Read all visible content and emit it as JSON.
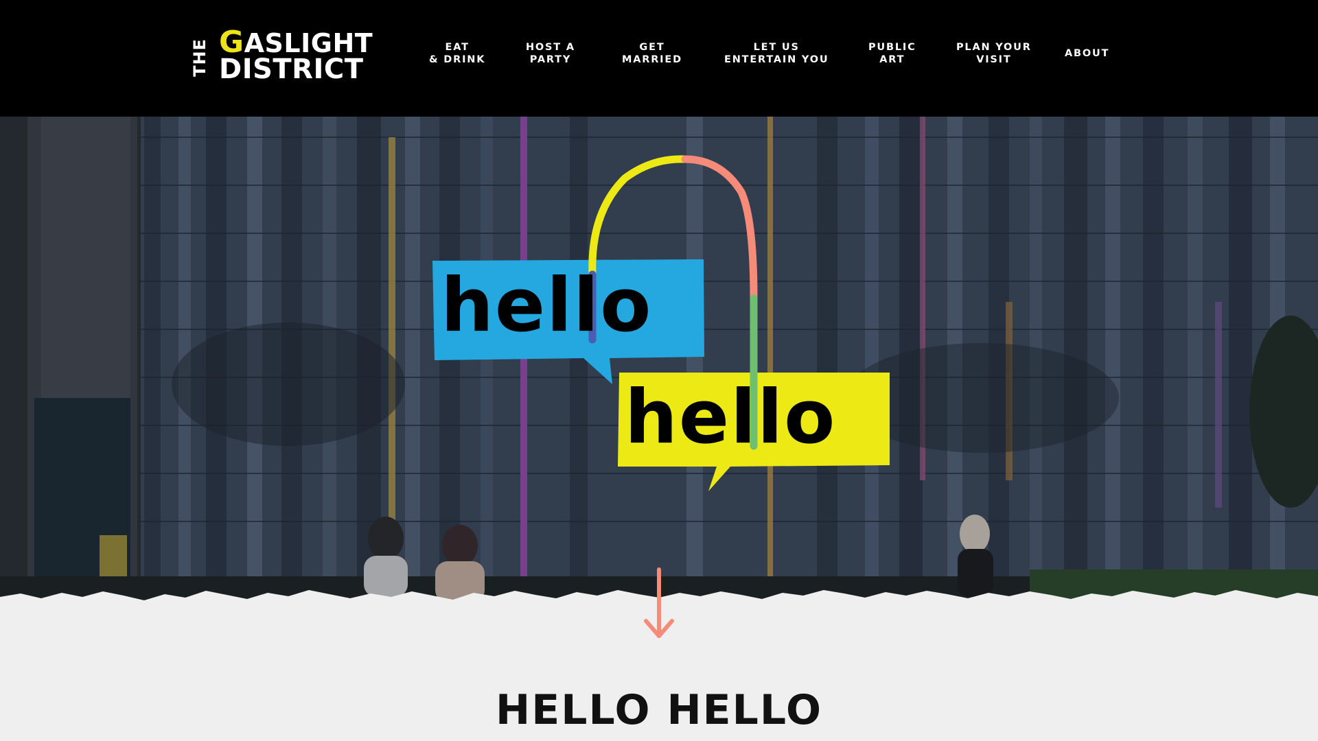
{
  "header": {
    "logo": {
      "the": "THE",
      "line1_g": "G",
      "line1_rest": "ASLIGHT",
      "line2": "DISTRICT"
    },
    "nav": [
      {
        "line1": "EAT",
        "line2": "& DRINK"
      },
      {
        "line1": "HOST A",
        "line2": "PARTY"
      },
      {
        "line1": "GET",
        "line2": "MARRIED"
      },
      {
        "line1": "LET US",
        "line2": "ENTERTAIN YOU"
      },
      {
        "line1": "PUBLIC",
        "line2": "ART"
      },
      {
        "line1": "PLAN YOUR",
        "line2": "VISIT"
      },
      {
        "line1": "ABOUT",
        "line2": ""
      }
    ]
  },
  "hero": {
    "bubble_top_text": "hello",
    "bubble_bottom_text": "hello",
    "colors": {
      "blue_bubble": "#25a8e0",
      "yellow_bubble": "#ece914",
      "arc_yellow": "#ece914",
      "arc_salmon": "#f58b78",
      "arc_green": "#6fbf73",
      "arc_blue": "#4a5db5"
    }
  },
  "scroll_arrow": {
    "icon": "arrow-down-icon",
    "color": "#f58b78"
  },
  "section": {
    "title": "HELLO HELLO"
  }
}
